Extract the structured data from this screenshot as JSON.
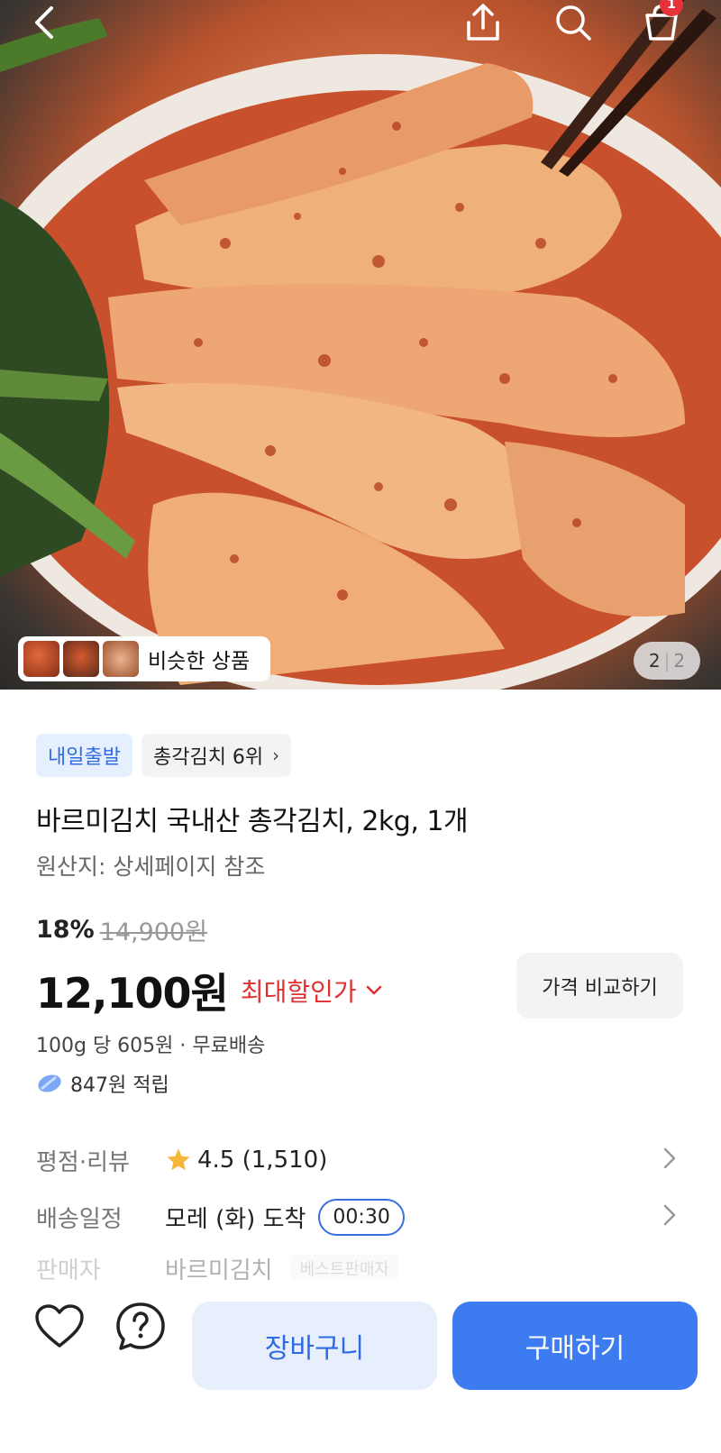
{
  "header": {
    "cart_badge": "1"
  },
  "gallery": {
    "similar_label": "비슷한 상품",
    "current_page": "2",
    "separator": "|",
    "total_pages": "2"
  },
  "tags": {
    "delivery": "내일출발",
    "ranking": "총각김치 6위",
    "ranking_chevron": "›"
  },
  "product": {
    "title": "바르미김치 국내산 총각김치, 2kg, 1개",
    "origin": "원산지: 상세페이지 참조"
  },
  "pricing": {
    "discount_percent": "18%",
    "original_price": "14,900원",
    "price": "12,100원",
    "max_discount_label": "최대할인가",
    "compare_button": "가격 비교하기",
    "unit_price_shipping": "100g 당 605원 · 무료배송",
    "points": "847원 적립"
  },
  "info_rows": {
    "rating": {
      "label": "평점·리뷰",
      "value": "4.5 (1,510)"
    },
    "delivery": {
      "label": "배송일정",
      "value": "모레 (화) 도착",
      "time": "00:30"
    },
    "seller": {
      "label": "판매자",
      "value": "바르미김치",
      "badge": "베스트판매자"
    }
  },
  "bottom_bar": {
    "cart_button": "장바구니",
    "buy_button": "구매하기"
  },
  "colors": {
    "accent_blue": "#3d7bf0",
    "discount_red": "#e0302f",
    "badge_red": "#e8323a",
    "star_yellow": "#f5b63a"
  }
}
